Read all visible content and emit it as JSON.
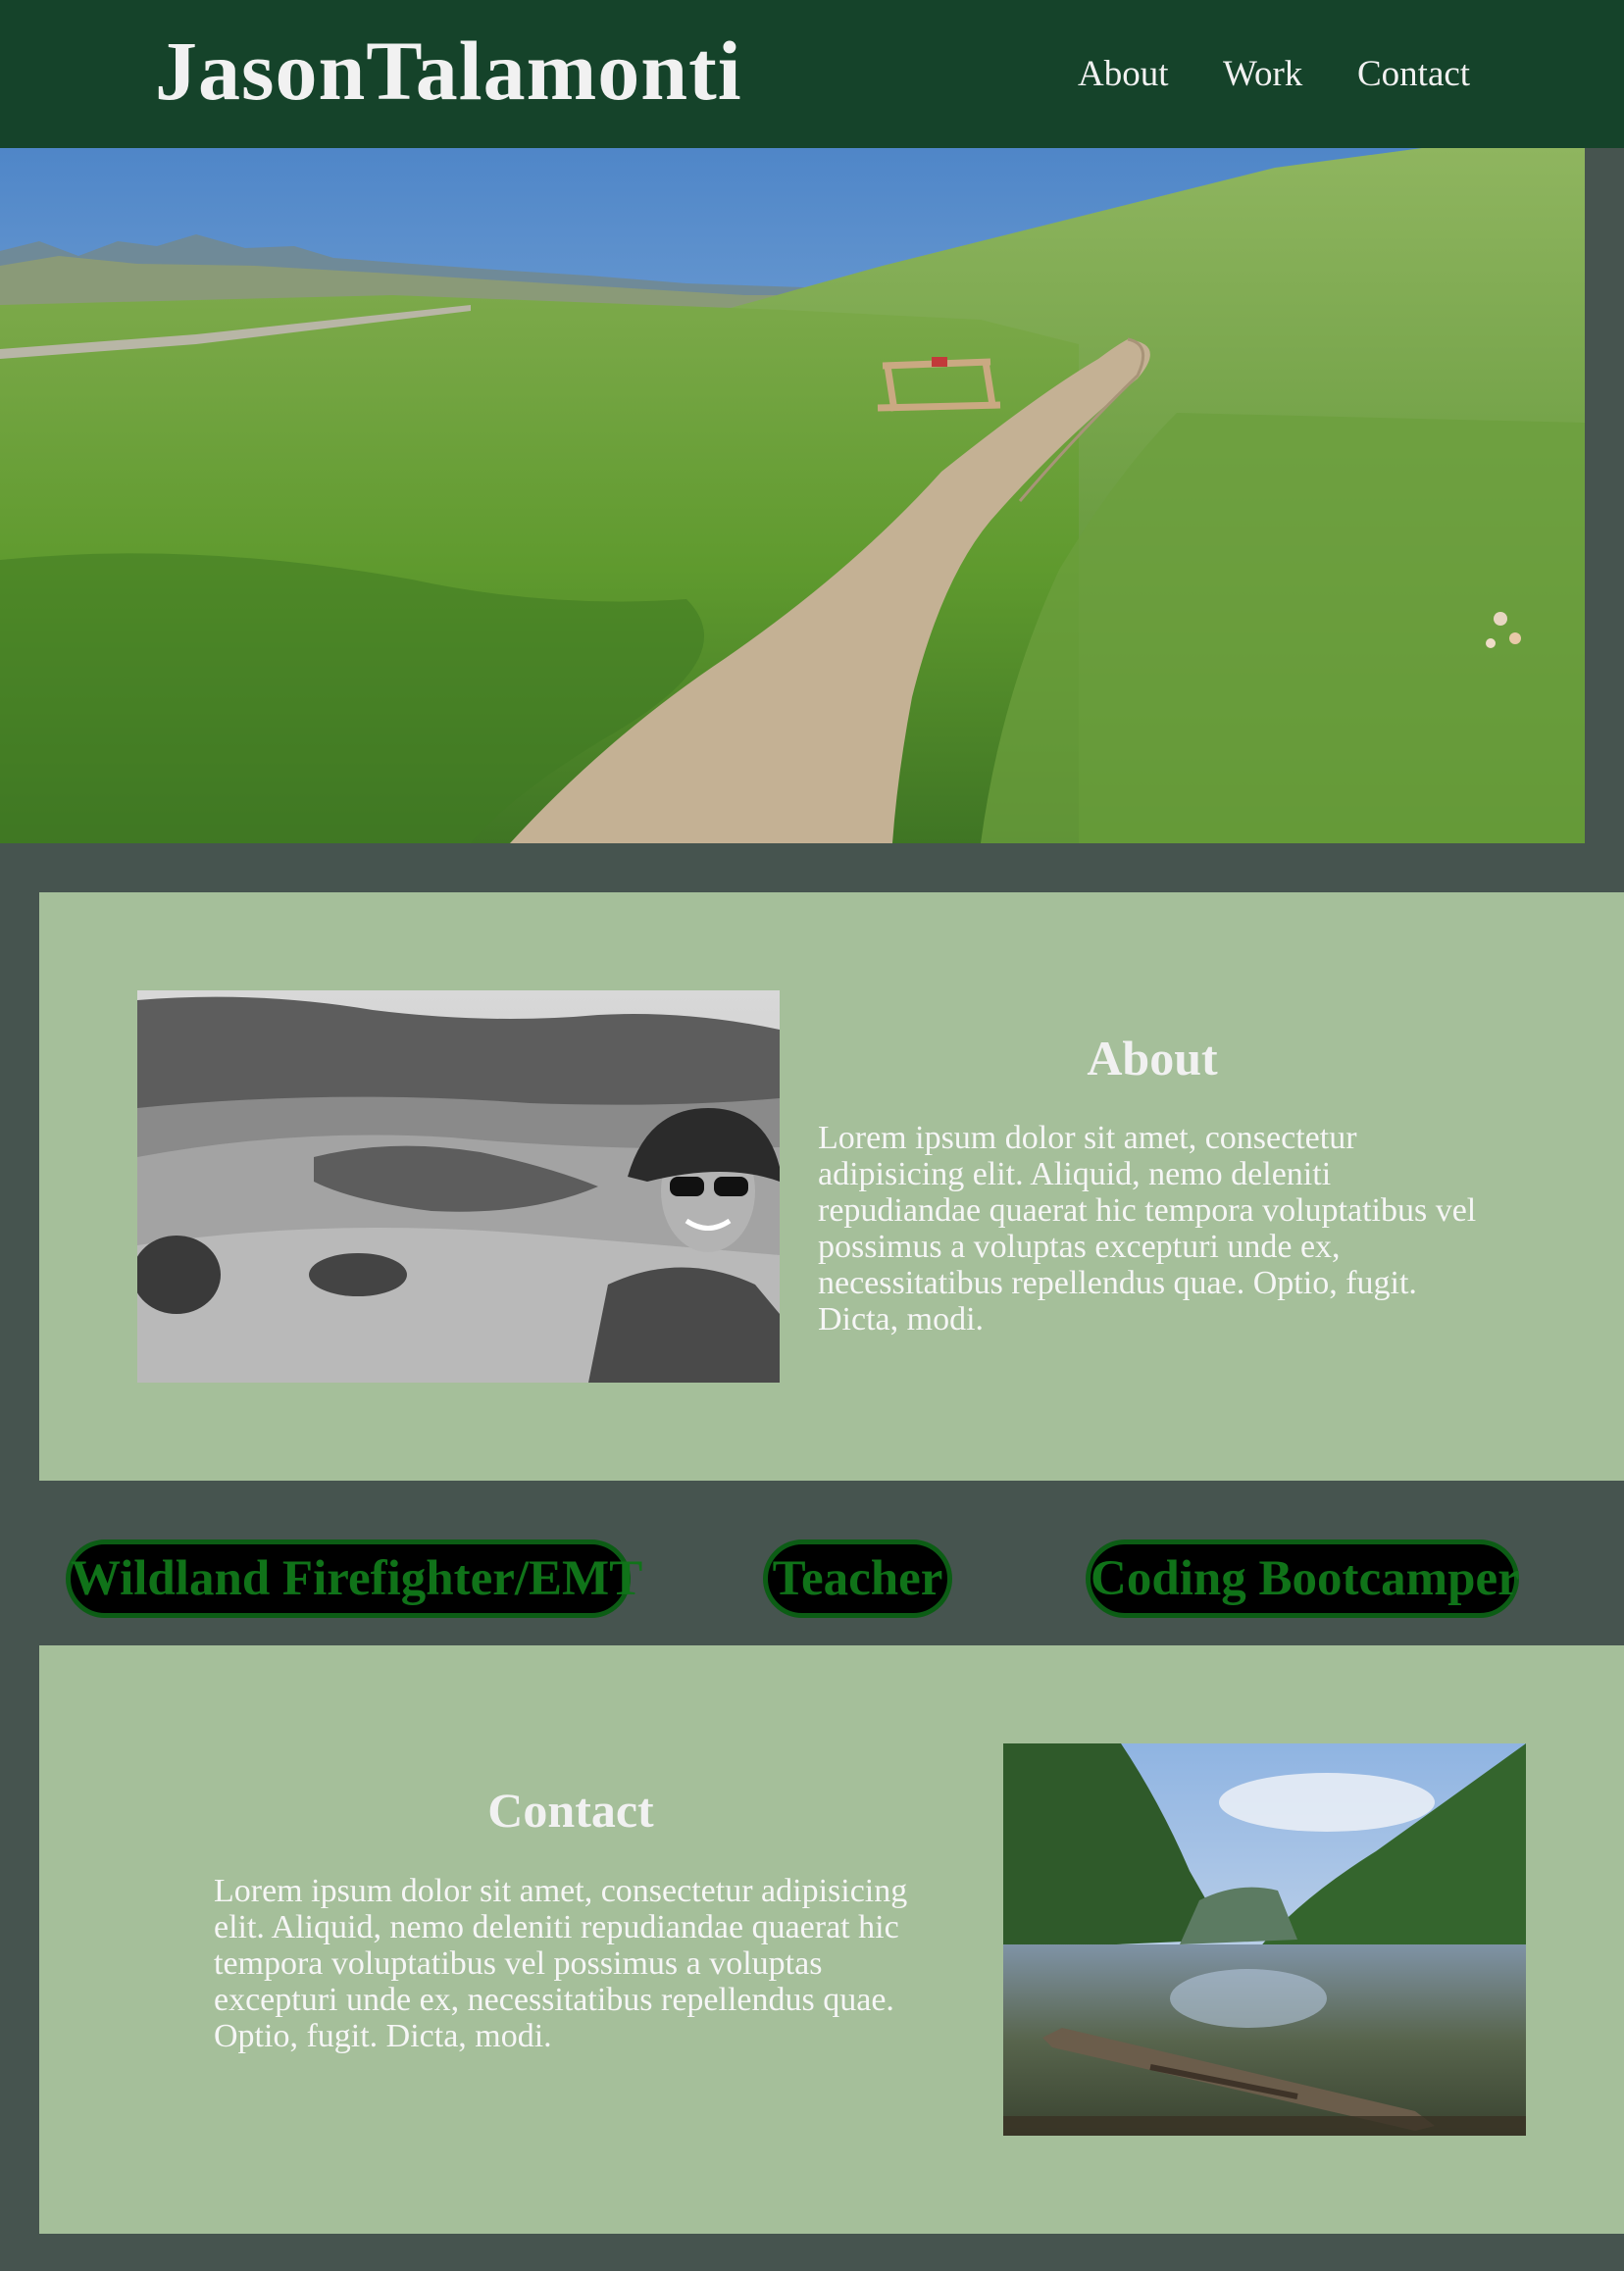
{
  "header": {
    "brand": "JasonTalamonti",
    "nav": [
      "About",
      "Work",
      "Contact"
    ]
  },
  "about": {
    "title": "About",
    "text": "Lorem ipsum dolor sit amet, consectetur adipisicing elit. Aliquid, nemo deleniti repudiandae quaerat hic tempora voluptatibus vel possimus a voluptas excepturi unde ex, necessitatibus repellendus quae. Optio, fugit. Dicta, modi."
  },
  "work": {
    "items": [
      "Wildland Firefighter/EMT",
      "Teacher",
      "Coding Bootcamper"
    ]
  },
  "contact": {
    "title": "Contact",
    "text": "Lorem ipsum dolor sit amet, consectetur adipisicing elit. Aliquid, nemo deleniti repudiandae quaerat hic tempora voluptatibus vel possimus a voluptas excepturi unde ex, necessitatibus repellendus quae. Optio, fugit. Dicta, modi."
  },
  "colors": {
    "header_bg": "#15432a",
    "page_bg": "#46544f",
    "panel_bg": "#a5bf9a",
    "pill_text": "#107319",
    "pill_border": "#0c5d15"
  }
}
